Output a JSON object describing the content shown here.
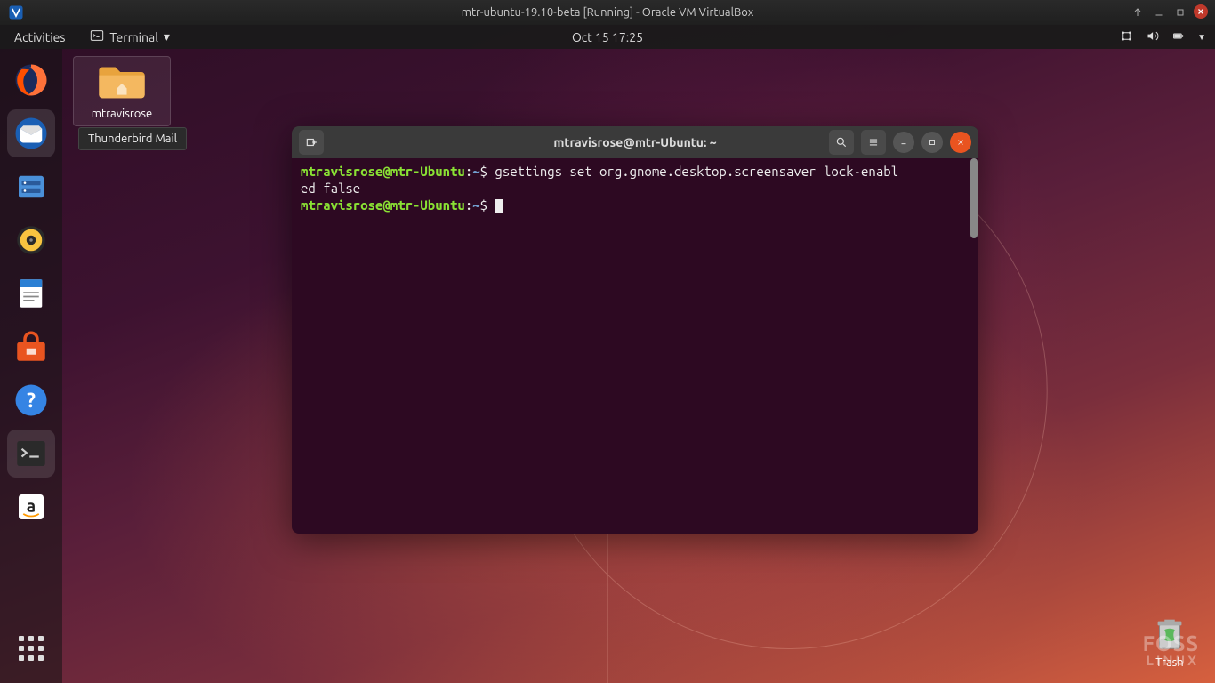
{
  "vbox": {
    "title": "mtr-ubuntu-19.10-beta [Running] - Oracle VM VirtualBox"
  },
  "topbar": {
    "activities": "Activities",
    "appmenu": "Terminal",
    "clock": "Oct 15  17:25"
  },
  "desktop_icon": {
    "label": "mtravisrose"
  },
  "tooltip": {
    "text": "Thunderbird Mail"
  },
  "terminal": {
    "title": "mtravisrose@mtr-Ubuntu: ~",
    "prompt_user": "mtravisrose@mtr-Ubuntu",
    "prompt_sep": ":",
    "prompt_path": "~",
    "prompt_dollar": "$",
    "line1_cmd": " gsettings set org.gnome.desktop.screensaver lock-enabl",
    "line1_wrap": "ed false"
  },
  "trash": {
    "label": "Trash"
  },
  "watermark": {
    "line1": "FOSS",
    "line2": "LINUX"
  }
}
